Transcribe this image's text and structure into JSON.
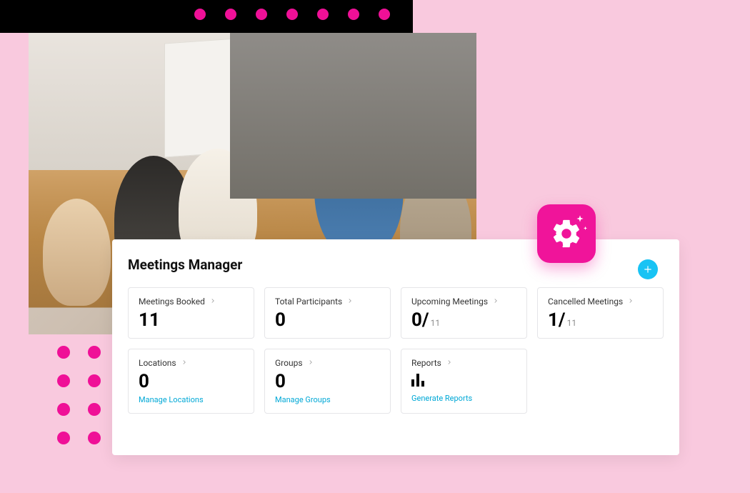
{
  "header": {
    "title": "Meetings Manager"
  },
  "tiles": {
    "meetings_booked": {
      "label": "Meetings Booked",
      "value": "11"
    },
    "total_participants": {
      "label": "Total Participants",
      "value": "0"
    },
    "upcoming": {
      "label": "Upcoming Meetings",
      "value": "0/",
      "denom": "11"
    },
    "cancelled": {
      "label": "Cancelled Meetings",
      "value": "1/",
      "denom": "11"
    },
    "locations": {
      "label": "Locations",
      "value": "0",
      "link": "Manage Locations"
    },
    "groups": {
      "label": "Groups",
      "value": "0",
      "link": "Manage Groups"
    },
    "reports": {
      "label": "Reports",
      "link": "Generate Reports"
    }
  },
  "colors": {
    "accent": "#ef1097",
    "link": "#00a8d6",
    "fab": "#18c3f4"
  }
}
